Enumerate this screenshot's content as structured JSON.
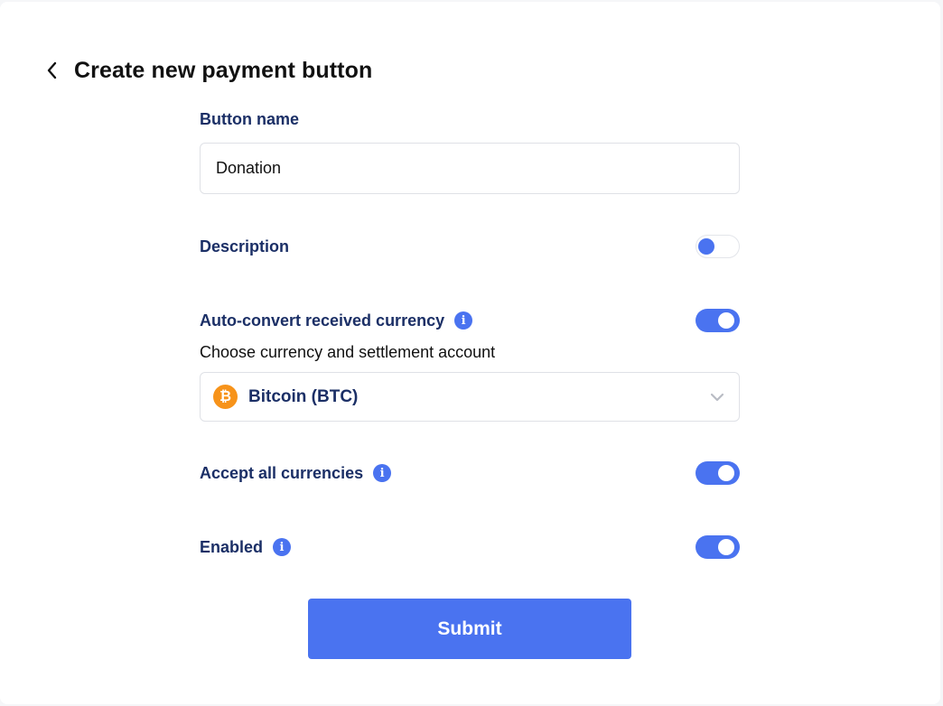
{
  "header": {
    "back_icon": "chevron-left-icon",
    "title": "Create new payment button"
  },
  "form": {
    "button_name": {
      "label": "Button name",
      "value": "Donation",
      "placeholder": ""
    },
    "description": {
      "label": "Description",
      "enabled": false
    },
    "auto_convert": {
      "label": "Auto-convert received currency",
      "info_icon": "info-icon",
      "enabled": true,
      "sublabel": "Choose currency and settlement account",
      "selected_currency": "Bitcoin (BTC)",
      "currency_icon": "bitcoin-icon",
      "currency_icon_glyph": "₿",
      "dropdown_icon": "chevron-down-icon"
    },
    "accept_all": {
      "label": "Accept all currencies",
      "info_icon": "info-icon",
      "enabled": true
    },
    "enabled": {
      "label": "Enabled",
      "info_icon": "info-icon",
      "enabled": true
    },
    "submit_label": "Submit"
  },
  "colors": {
    "accent": "#4a73f0",
    "label_text": "#1b2f66",
    "bitcoin": "#f7931a"
  }
}
